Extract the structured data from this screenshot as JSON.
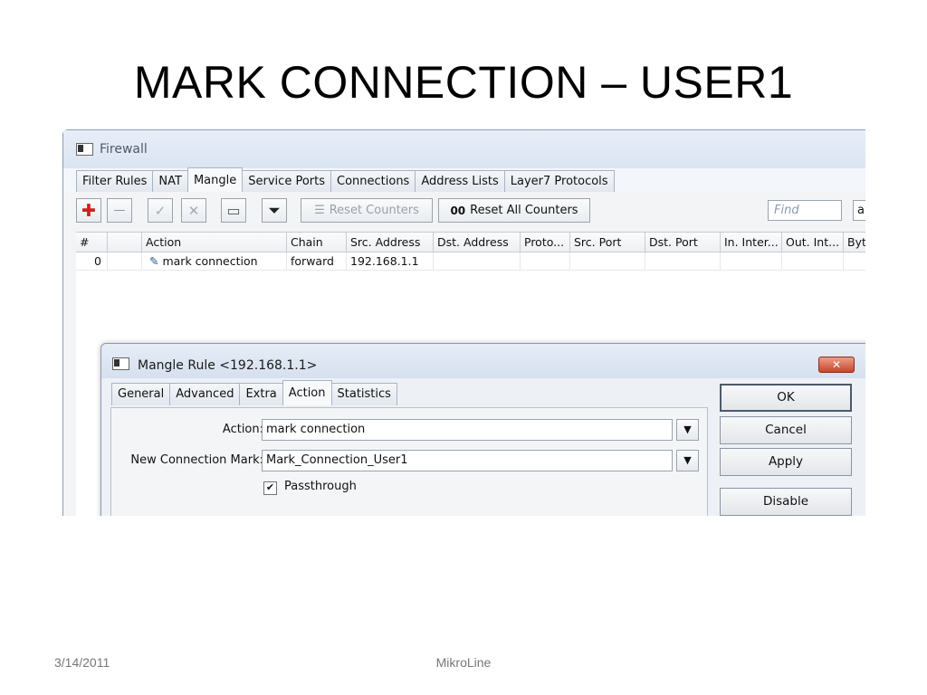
{
  "slide": {
    "title": "MARK CONNECTION – USER1",
    "date": "3/14/2011",
    "footer": "MikroLine"
  },
  "firewall": {
    "title": "Firewall",
    "tabs": [
      "Filter Rules",
      "NAT",
      "Mangle",
      "Service Ports",
      "Connections",
      "Address Lists",
      "Layer7 Protocols"
    ],
    "active_tab": "Mangle",
    "toolbar": {
      "add_glyph": "✚",
      "remove_glyph": "—",
      "enable_glyph": "✓",
      "disable_glyph": "✕",
      "comment_glyph": "▭",
      "filter_glyph": "⏷",
      "reset_counters_label": "Reset Counters",
      "reset_all_counters_label": "Reset All Counters",
      "reset_all_glyph": "00",
      "find_placeholder": "Find",
      "find_extra": "a"
    },
    "columns": [
      "#",
      "",
      "Action",
      "Chain",
      "Src. Address",
      "Dst. Address",
      "Proto...",
      "Src. Port",
      "Dst. Port",
      "In. Inter...",
      "Out. Int...",
      "Byt"
    ],
    "rows": [
      {
        "num": "0",
        "action": "mark connection",
        "chain": "forward",
        "src_address": "192.168.1.1"
      }
    ]
  },
  "dialog": {
    "title": "Mangle Rule <192.168.1.1>",
    "close_glyph": "✕",
    "tabs": [
      "General",
      "Advanced",
      "Extra",
      "Action",
      "Statistics"
    ],
    "active_tab": "Action",
    "fields": {
      "action_label": "Action:",
      "action_value": "mark connection",
      "new_connection_mark_label": "New Connection Mark:",
      "new_connection_mark_value": "Mark_Connection_User1",
      "passthrough_label": "Passthrough",
      "passthrough_checked": true,
      "dropdown_glyph": "▼"
    },
    "buttons": {
      "ok": "OK",
      "cancel": "Cancel",
      "apply": "Apply",
      "disable": "Disable"
    }
  },
  "colors": {
    "add_icon": "#d21f1f",
    "dialog_close": "#c8442a"
  }
}
